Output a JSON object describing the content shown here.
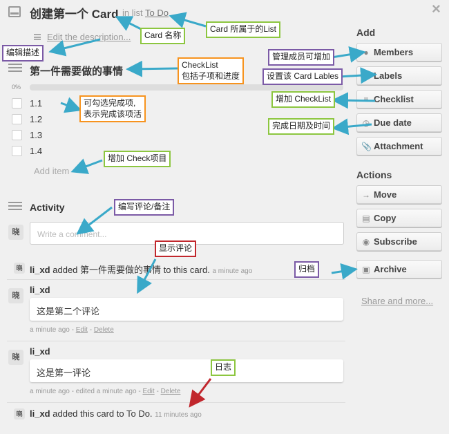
{
  "header": {
    "title": "创建第一个 Card",
    "in_list_prefix": "in list",
    "list_name": "To Do",
    "close": "×"
  },
  "description": {
    "edit_link": "Edit the description..."
  },
  "checklist": {
    "title": "第一件需要做的事情",
    "percent": "0%",
    "progress": 0,
    "items": [
      "1.1",
      "1.2",
      "1.3",
      "1.4"
    ],
    "add_item": "Add item"
  },
  "activity": {
    "title": "Activity",
    "comment_placeholder": "Write a comment...",
    "avatar_char": "晓",
    "feed": {
      "action1": {
        "user": "li_xd",
        "text": "added 第一件需要做的事情 to this card.",
        "time": "a minute ago"
      },
      "comment1": {
        "user": "li_xd",
        "body": "这是第二个评论",
        "time": "a minute ago",
        "edit": "Edit",
        "delete": "Delete"
      },
      "comment2": {
        "user": "li_xd",
        "body": "这是第一评论",
        "time": "a minute ago - edited a minute ago",
        "edit": "Edit",
        "delete": "Delete"
      },
      "action2": {
        "user": "li_xd",
        "text": "added this card to To Do.",
        "time": "11 minutes ago"
      }
    }
  },
  "sidebar": {
    "add_heading": "Add",
    "add_buttons": [
      {
        "label": "Members",
        "icon": "person-icon"
      },
      {
        "label": "Labels",
        "icon": "tag-icon"
      },
      {
        "label": "Checklist",
        "icon": "checklist-icon"
      },
      {
        "label": "Due date",
        "icon": "clock-icon"
      },
      {
        "label": "Attachment",
        "icon": "paperclip-icon"
      }
    ],
    "actions_heading": "Actions",
    "action_buttons": [
      {
        "label": "Move",
        "icon": "arrow-right-icon"
      },
      {
        "label": "Copy",
        "icon": "copy-icon"
      },
      {
        "label": "Subscribe",
        "icon": "eye-icon"
      },
      {
        "label": "Archive",
        "icon": "archive-icon"
      }
    ],
    "share": "Share and more..."
  },
  "annotations": {
    "card_name": "Card 名称",
    "card_list": "Card 所属于的List",
    "edit_desc": "编辑描述",
    "checklist_a": "CheckList",
    "checklist_b": "包括子项和进度",
    "members": "管理成员可增加",
    "labels": "设置该 Card Lables",
    "check_item_a": "可勾选完成项,",
    "check_item_b": "表示完成该项活",
    "add_checklist": "增加 CheckList",
    "due_date": "完成日期及时间",
    "add_check_item": "增加 Check项目",
    "write_comment": "编写评论/备注",
    "show_comment": "显示评论",
    "archive": "归档",
    "log": "日志"
  },
  "colors": {
    "green": "#8cc63f",
    "purple": "#7b5aa6",
    "orange": "#f7931e",
    "red": "#c1272d",
    "arrow": "#3aa9c9",
    "progress": "#8bbd4a"
  }
}
